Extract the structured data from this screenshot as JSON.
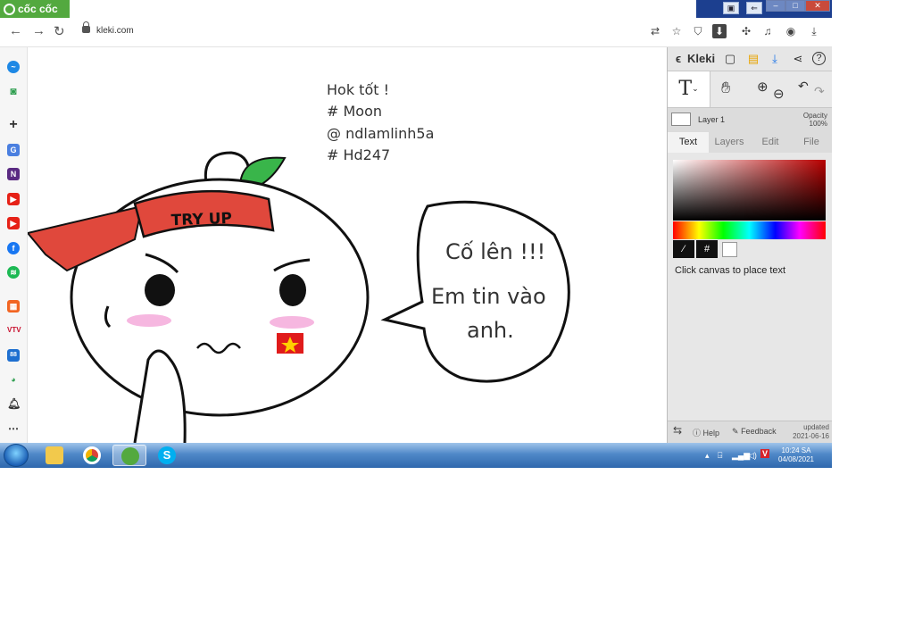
{
  "browser": {
    "brand_name": "cốc cốc",
    "url": "kleki.com",
    "nav": {
      "back": "←",
      "forward": "→",
      "reload": "↻"
    }
  },
  "canvas": {
    "notes": [
      "Hok tốt !",
      "# Moon",
      "@ ndlamlinh5a",
      " # Hd247"
    ],
    "headband_text": "TRY UP",
    "speech": {
      "line1": "Cố lên !!!",
      "line2": "Em tin vào",
      "line3": "anh."
    }
  },
  "panel": {
    "logo": "Kleki",
    "tool_text_glyph": "T",
    "layer_name": "Layer 1",
    "opacity_label": "Opacity",
    "opacity_value": "100%",
    "tabs": [
      "Text",
      "Layers",
      "Edit",
      "File"
    ],
    "active_tab": "Text",
    "hint": "Click canvas to place text",
    "swatch_hash": "#",
    "footer": {
      "help": "Help",
      "feedback": "Feedback",
      "updated_label": "updated",
      "updated_date": "2021-06-16"
    }
  },
  "taskbar": {
    "time": "10:24 SA",
    "date": "04/08/2021"
  },
  "colors": {
    "brand_green": "#53a93f",
    "headband_red": "#e0483c",
    "taskbar_blue": "#4f88c8"
  }
}
